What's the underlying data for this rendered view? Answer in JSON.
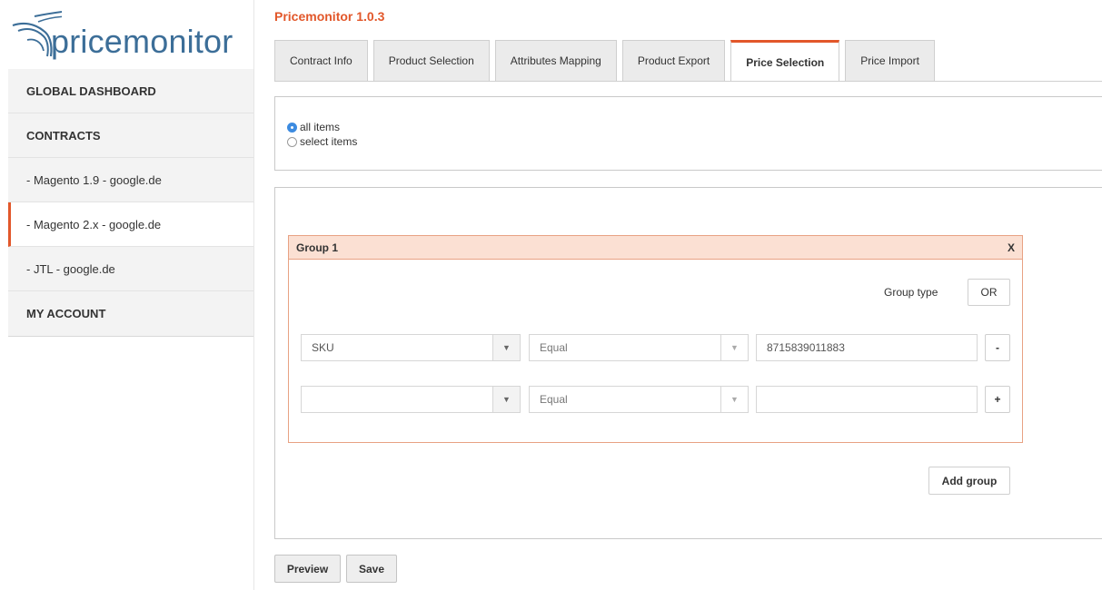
{
  "brand": {
    "logo_text": "pricemonitor"
  },
  "sidebar": {
    "items": [
      {
        "label": "GLOBAL DASHBOARD",
        "type": "heading"
      },
      {
        "label": "CONTRACTS",
        "type": "heading"
      },
      {
        "label": "- Magento 1.9 - google.de",
        "type": "link"
      },
      {
        "label": "- Magento 2.x - google.de",
        "type": "link",
        "active": true
      },
      {
        "label": "- JTL - google.de",
        "type": "link"
      },
      {
        "label": "MY ACCOUNT",
        "type": "heading"
      }
    ]
  },
  "header": {
    "title": "Pricemonitor 1.0.3"
  },
  "tabs": [
    {
      "label": "Contract Info"
    },
    {
      "label": "Product Selection"
    },
    {
      "label": "Attributes Mapping"
    },
    {
      "label": "Product Export"
    },
    {
      "label": "Price Selection",
      "active": true
    },
    {
      "label": "Price Import"
    }
  ],
  "selection": {
    "options": [
      {
        "label": "all items",
        "checked": true
      },
      {
        "label": "select items",
        "checked": false
      }
    ]
  },
  "group": {
    "title": "Group 1",
    "close_label": "X",
    "type_label": "Group type",
    "type_value": "OR",
    "rows": [
      {
        "attribute": "SKU",
        "operator": "Equal",
        "value": "8715839011883",
        "action": "-"
      },
      {
        "attribute": "",
        "operator": "Equal",
        "value": "",
        "action": "+"
      }
    ]
  },
  "add_group_label": "Add group",
  "footer": {
    "preview_label": "Preview",
    "save_label": "Save"
  },
  "colors": {
    "accent": "#e2572a",
    "brand_blue": "#3c6e98",
    "group_header_bg": "#fbe0d3",
    "radio_blue": "#3d8be0"
  }
}
